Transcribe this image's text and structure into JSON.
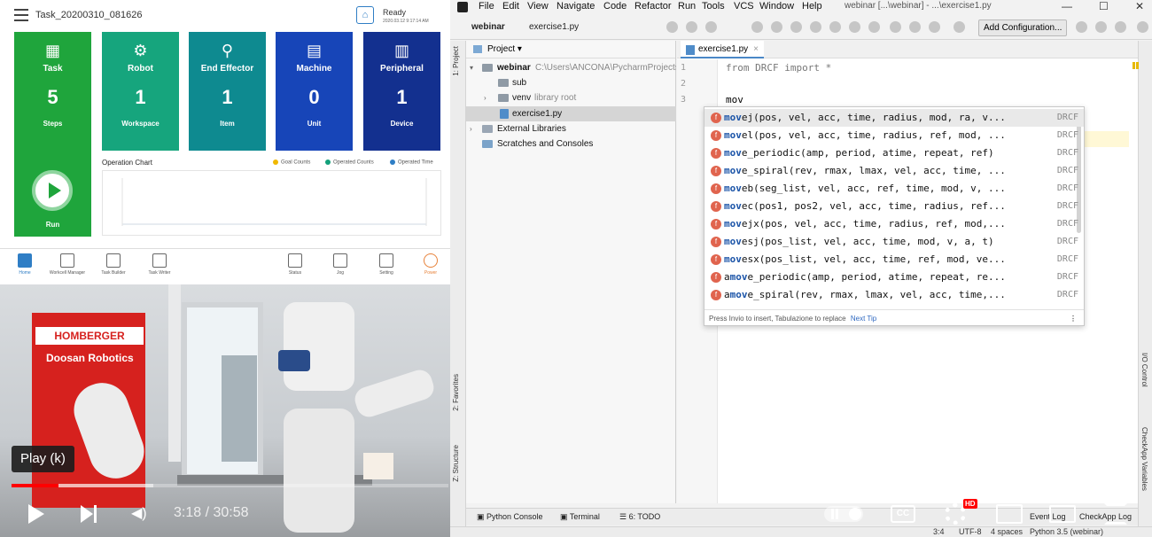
{
  "pendant": {
    "task_name": "Task_20200310_081626",
    "status": "Ready",
    "status_time": "2020.03.12 9:17:14 AM",
    "tiles": [
      {
        "label": "Task",
        "value": "5",
        "unit": "Steps"
      },
      {
        "label": "Robot",
        "value": "1",
        "unit": "Workspace"
      },
      {
        "label": "End Effector",
        "value": "1",
        "unit": "Item"
      },
      {
        "label": "Machine",
        "value": "0",
        "unit": "Unit"
      },
      {
        "label": "Peripheral",
        "value": "1",
        "unit": "Device"
      }
    ],
    "run_label": "Run",
    "chart_title": "Operation Chart",
    "legend": [
      "Goal Counts",
      "Operated Counts",
      "Operated Time"
    ],
    "legend_colors": [
      "#f0b800",
      "#13a07a",
      "#2f7ec5"
    ],
    "nav": [
      "Home",
      "Workcell Manager",
      "Task Builder",
      "Task Writer",
      "Status",
      "Jog",
      "Setting",
      "Power"
    ]
  },
  "video": {
    "banner_logo": "HOMBERGER",
    "banner_title": "Doosan Robotics",
    "tooltip": "Play (k)",
    "time": "3:18 / 30:58",
    "played_fraction": 0.107,
    "buffered_fraction": 0.325,
    "hd_badge": "HD",
    "cc_label": "CC"
  },
  "ide": {
    "menu": [
      "File",
      "Edit",
      "View",
      "Navigate",
      "Code",
      "Refactor",
      "Run",
      "Tools",
      "VCS",
      "Window",
      "Help"
    ],
    "window_title": "webinar [...\\webinar] - ...\\exercise1.py",
    "breadcrumb": [
      "webinar",
      "exercise1.py"
    ],
    "add_config": "Add Configuration...",
    "project_header": "Project",
    "tree": [
      {
        "name": "webinar",
        "note": "C:\\Users\\ANCONA\\PycharmProjects\\webinar"
      },
      {
        "name": "sub",
        "note": ""
      },
      {
        "name": "venv",
        "note": "library root"
      },
      {
        "name": "exercise1.py",
        "note": ""
      },
      {
        "name": "External Libraries",
        "note": ""
      },
      {
        "name": "Scratches and Consoles",
        "note": ""
      }
    ],
    "tab_name": "exercise1.py",
    "lines": [
      {
        "no": "1",
        "text": "from DRCF import *"
      },
      {
        "no": "2",
        "text": ""
      },
      {
        "no": "3",
        "text": "mov"
      }
    ],
    "suggestions": [
      {
        "name": "movej",
        "args": "(pos, vel, acc, time, radius, mod, ra, v...",
        "src": "DRCF"
      },
      {
        "name": "movel",
        "args": "(pos, vel, acc, time, radius, ref, mod, ...",
        "src": "DRCF"
      },
      {
        "name": "move_periodic",
        "args": "(amp, period, atime, repeat, ref)",
        "src": "DRCF"
      },
      {
        "name": "move_spiral",
        "args": "(rev, rmax, lmax, vel, acc, time, ...",
        "src": "DRCF"
      },
      {
        "name": "moveb",
        "args": "(seg_list, vel, acc, ref, time, mod, v, ...",
        "src": "DRCF"
      },
      {
        "name": "movec",
        "args": "(pos1, pos2, vel, acc, time, radius, ref...",
        "src": "DRCF"
      },
      {
        "name": "movejx",
        "args": "(pos, vel, acc, time, radius, ref, mod,...",
        "src": "DRCF"
      },
      {
        "name": "movesj",
        "args": "(pos_list, vel, acc, time, mod, v, a, t)",
        "src": "DRCF"
      },
      {
        "name": "movesx",
        "args": "(pos_list, vel, acc, time, ref, mod, ve...",
        "src": "DRCF"
      },
      {
        "name": "amove_periodic",
        "args": "(amp, period, atime, repeat, re...",
        "src": "DRCF"
      },
      {
        "name": "amove_spiral",
        "args": "(rev, rmax, lmax, vel, acc, time,...",
        "src": "DRCF"
      }
    ],
    "popup_hint": "Press Invio to insert, Tabulazione to replace",
    "next_tip": "Next Tip",
    "side_left": [
      "1: Project",
      "2: Favorites",
      "Z: Structure"
    ],
    "side_right": [
      "I/O Control",
      "CheckApp Variables"
    ],
    "bottom_tabs": [
      "Python Console",
      "Terminal",
      "6: TODO",
      "Event Log",
      "CheckApp Log"
    ],
    "status": [
      "3:4",
      "UTF-8",
      "4 spaces",
      "Python 3.5 (webinar)"
    ]
  }
}
